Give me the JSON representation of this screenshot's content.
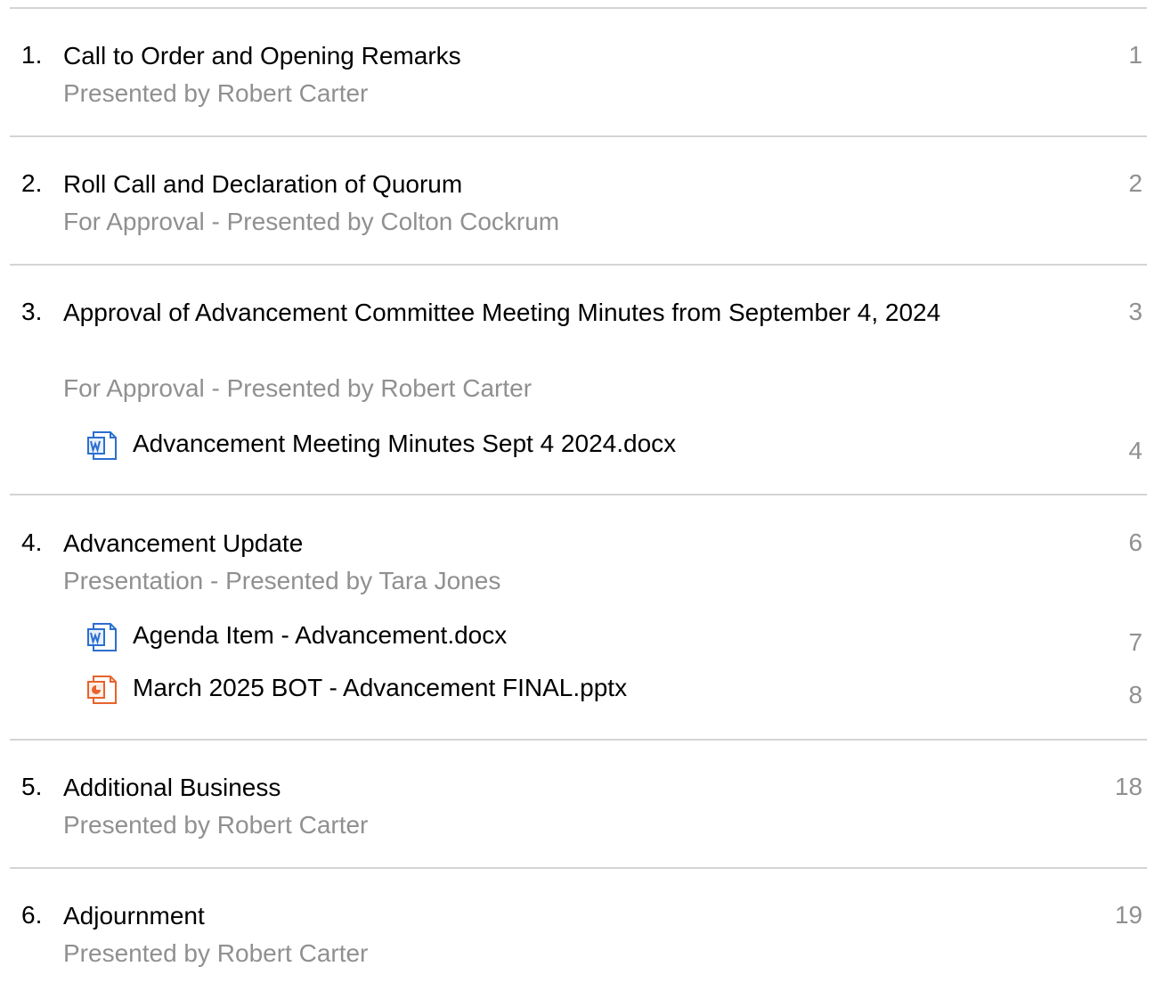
{
  "items": [
    {
      "number": "1.",
      "title": "Call to Order and Opening Remarks",
      "subtitle": "Presented by Robert Carter",
      "page": "1"
    },
    {
      "number": "2.",
      "title": "Roll Call and Declaration of Quorum",
      "subtitle": "For Approval - Presented by Colton Cockrum",
      "page": "2"
    },
    {
      "number": "3.",
      "title": "Approval of Advancement Committee Meeting Minutes from September 4, 2024",
      "subtitle": "For Approval - Presented by Robert Carter",
      "page": "3",
      "attachments": [
        {
          "icon": "word-doc-icon",
          "name": "Advancement Meeting Minutes Sept 4 2024.docx",
          "page": "4"
        }
      ]
    },
    {
      "number": "4.",
      "title": "Advancement Update",
      "subtitle": "Presentation - Presented by Tara Jones",
      "page": "6",
      "attachments": [
        {
          "icon": "word-doc-icon",
          "name": "Agenda Item - Advancement.docx",
          "page": "7"
        },
        {
          "icon": "powerpoint-icon",
          "name": "March 2025 BOT - Advancement FINAL.pptx",
          "page": "8"
        }
      ]
    },
    {
      "number": "5.",
      "title": "Additional Business",
      "subtitle": "Presented by Robert Carter",
      "page": "18"
    },
    {
      "number": "6.",
      "title": "Adjournment",
      "subtitle": "Presented by Robert Carter",
      "page": "19"
    }
  ],
  "colors": {
    "word_blue": "#2b6fcf",
    "ppt_orange": "#e8622c",
    "muted_text": "#909090",
    "divider": "#d4d4d4"
  }
}
